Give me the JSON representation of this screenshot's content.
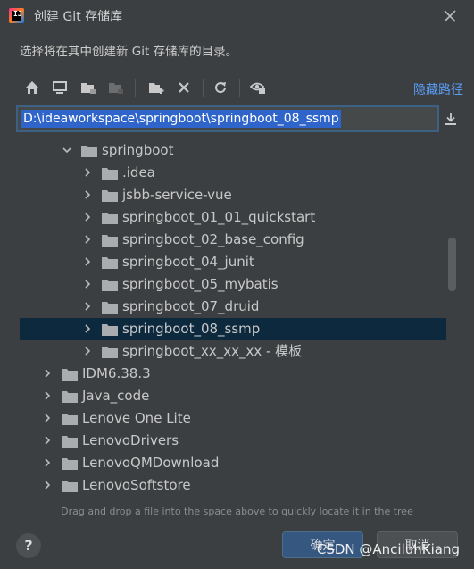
{
  "window": {
    "title": "创建 Git 存储库"
  },
  "description": "选择将在其中创建新 Git 存储库的目录。",
  "toolbar": {
    "buttons": [
      "home-icon",
      "desktop-icon",
      "project-folder-icon",
      "module-folder-icon",
      "new-folder-icon",
      "delete-icon",
      "refresh-icon",
      "show-hidden-icon"
    ],
    "hide_path_label": "隐藏路径"
  },
  "path": {
    "value": "D:\\ideaworkspace\\springboot\\springboot_08_ssmp"
  },
  "tree": {
    "rows": [
      {
        "label": "springboot",
        "depth": 1,
        "expanded": true,
        "selected": false
      },
      {
        "label": ".idea",
        "depth": 2,
        "expanded": false,
        "selected": false
      },
      {
        "label": "jsbb-service-vue",
        "depth": 2,
        "expanded": false,
        "selected": false
      },
      {
        "label": "springboot_01_01_quickstart",
        "depth": 2,
        "expanded": false,
        "selected": false
      },
      {
        "label": "springboot_02_base_config",
        "depth": 2,
        "expanded": false,
        "selected": false
      },
      {
        "label": "springboot_04_junit",
        "depth": 2,
        "expanded": false,
        "selected": false
      },
      {
        "label": "springboot_05_mybatis",
        "depth": 2,
        "expanded": false,
        "selected": false
      },
      {
        "label": "springboot_07_druid",
        "depth": 2,
        "expanded": false,
        "selected": false
      },
      {
        "label": "springboot_08_ssmp",
        "depth": 2,
        "expanded": false,
        "selected": true
      },
      {
        "label": "springboot_xx_xx_xx - 模板",
        "depth": 2,
        "expanded": false,
        "selected": false
      },
      {
        "label": "IDM6.38.3",
        "depth": 0,
        "expanded": false,
        "selected": false
      },
      {
        "label": "Java_code",
        "depth": 0,
        "expanded": false,
        "selected": false
      },
      {
        "label": "Lenove One Lite",
        "depth": 0,
        "expanded": false,
        "selected": false
      },
      {
        "label": "LenovoDrivers",
        "depth": 0,
        "expanded": false,
        "selected": false
      },
      {
        "label": "LenovoQMDownload",
        "depth": 0,
        "expanded": false,
        "selected": false
      },
      {
        "label": "LenovoSoftstore",
        "depth": 0,
        "expanded": false,
        "selected": false
      }
    ]
  },
  "hint": "Drag and drop a file into the space above to quickly locate it in the tree",
  "footer": {
    "help": "?",
    "ok": "确定",
    "cancel": "取消"
  },
  "watermark": "CSDN @AnciluhKiang",
  "colors": {
    "background": "#3c3f41",
    "selection": "#0d293e",
    "accent": "#589df6",
    "input_highlight": "#2f65ca"
  }
}
